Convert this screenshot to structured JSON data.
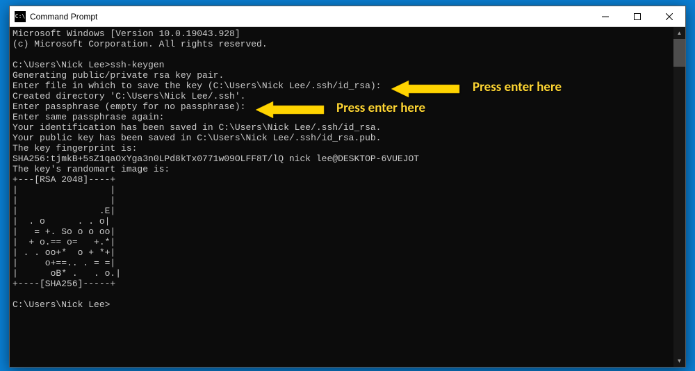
{
  "window": {
    "title": "Command Prompt",
    "icon_label": "C:\\"
  },
  "terminal": {
    "lines": [
      "Microsoft Windows [Version 10.0.19043.928]",
      "(c) Microsoft Corporation. All rights reserved.",
      "",
      "C:\\Users\\Nick Lee>ssh-keygen",
      "Generating public/private rsa key pair.",
      "Enter file in which to save the key (C:\\Users\\Nick Lee/.ssh/id_rsa):",
      "Created directory 'C:\\Users\\Nick Lee/.ssh'.",
      "Enter passphrase (empty for no passphrase):",
      "Enter same passphrase again:",
      "Your identification has been saved in C:\\Users\\Nick Lee/.ssh/id_rsa.",
      "Your public key has been saved in C:\\Users\\Nick Lee/.ssh/id_rsa.pub.",
      "The key fingerprint is:",
      "SHA256:tjmkB+5sZ1qaOxYga3n0LPd8kTx0771w09OLFF8T/lQ nick lee@DESKTOP-6VUEJOT",
      "The key's randomart image is:",
      "+---[RSA 2048]----+",
      "|                 |",
      "|                 |",
      "|               .E|",
      "|  . o      . . o|",
      "|   = +. So o o oo|",
      "|  + o.== o=   +.*|",
      "| . . oo+*  o + *+|",
      "|     o+==.. . = =|",
      "|      oB* .   . o.|",
      "+----[SHA256]-----+",
      "",
      "C:\\Users\\Nick Lee>"
    ]
  },
  "annotations": {
    "arrow1_label": "Press enter here",
    "arrow2_label": "Press enter here"
  }
}
